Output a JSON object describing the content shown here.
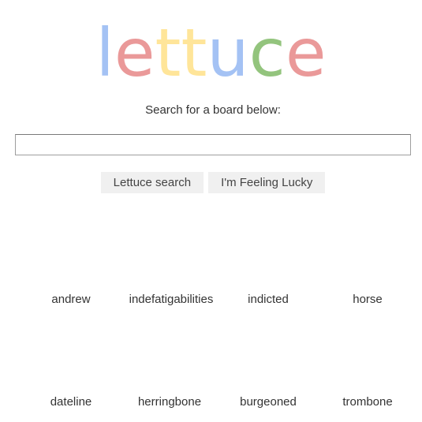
{
  "logo": {
    "letters": [
      {
        "char": "l",
        "color": "#a4c2f4"
      },
      {
        "char": "e",
        "color": "#ea9999"
      },
      {
        "char": "t",
        "color": "#ffe599"
      },
      {
        "char": "t",
        "color": "#ffe599"
      },
      {
        "char": "u",
        "color": "#a4c2f4"
      },
      {
        "char": "c",
        "color": "#93c47d"
      },
      {
        "char": "e",
        "color": "#ea9999"
      }
    ]
  },
  "prompt": "Search for a board below:",
  "search": {
    "value": "",
    "placeholder": ""
  },
  "buttons": {
    "search_label": "Lettuce search",
    "lucky_label": "I'm Feeling Lucky"
  },
  "boards": [
    {
      "label": "andrew"
    },
    {
      "label": "indefatigabilities"
    },
    {
      "label": "indicted"
    },
    {
      "label": "horse"
    },
    {
      "label": "dateline"
    },
    {
      "label": "herringbone"
    },
    {
      "label": "burgeoned"
    },
    {
      "label": "trombone"
    }
  ]
}
